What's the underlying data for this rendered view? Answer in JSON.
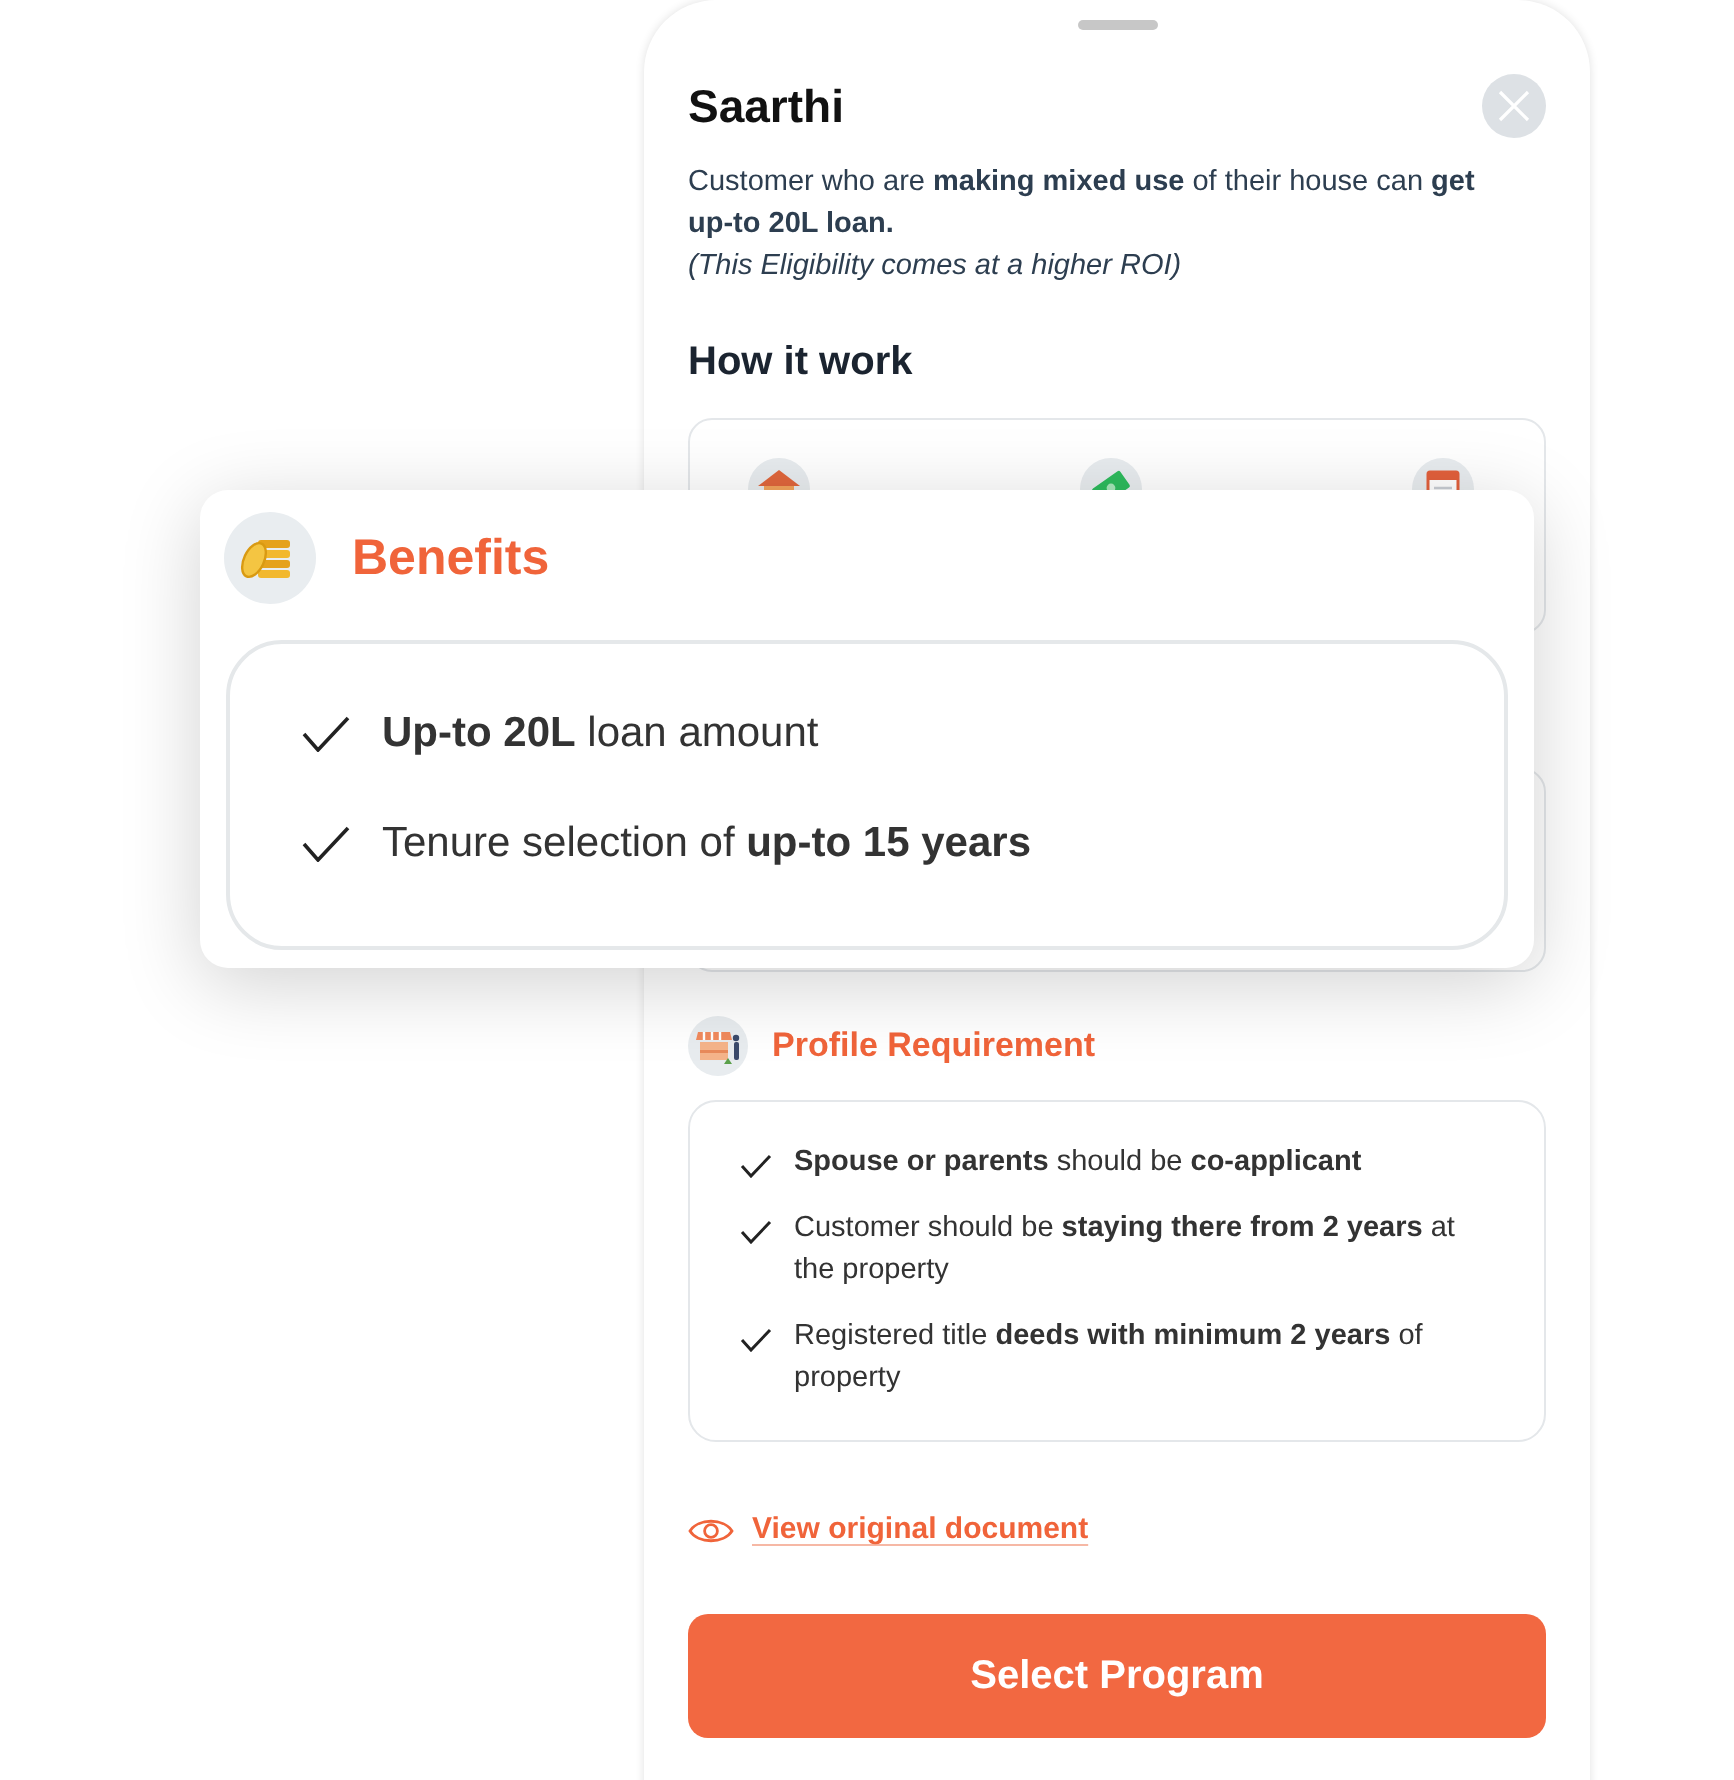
{
  "sheet": {
    "title": "Saarthi",
    "description": "Customer who are **making mixed use** of their house can **get up-to 20L loan.**",
    "note": "(This Eligibility comes at a higher ROI)"
  },
  "how_it_works": {
    "title": "How it work"
  },
  "benefits": {
    "title": "Benefits",
    "items": [
      "**Up-to 20L** loan amount",
      "Tenure selection of **up-to 15 years**"
    ]
  },
  "profile_requirement": {
    "title": "Profile Requirement",
    "items": [
      "**Spouse or parents** should be **co-applicant**",
      "Customer should be **staying there from 2 years** at the property",
      "Registered title **deeds with minimum 2 years** of property"
    ]
  },
  "document_link": "View original document",
  "primary_button": "Select Program"
}
